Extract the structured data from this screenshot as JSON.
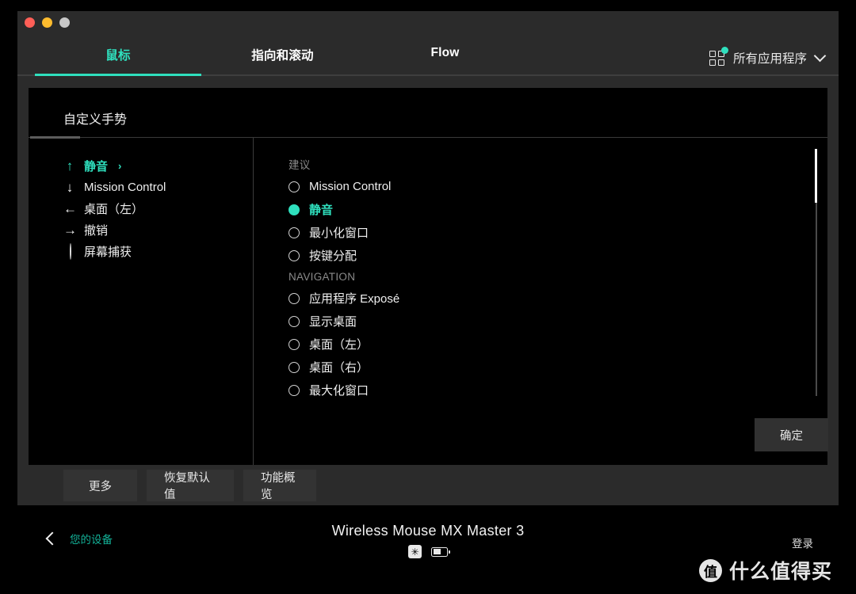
{
  "window": {
    "traffic_lights": [
      "close",
      "minimize",
      "zoom"
    ],
    "accent_color": "#2fe0be",
    "chrome_color": "#2b2b2b"
  },
  "tabs": [
    {
      "label": "鼠标",
      "active": true
    },
    {
      "label": "指向和滚动",
      "active": false
    },
    {
      "label": "Flow",
      "active": false
    }
  ],
  "all_apps": {
    "label": "所有应用程序",
    "icon": "grid-icon",
    "chevron": "chevron-down-icon"
  },
  "dialog": {
    "title": "自定义手势",
    "gestures": [
      {
        "icon": "arrow-up",
        "glyph": "↑",
        "label": "静音",
        "active": true,
        "chevron": "›"
      },
      {
        "icon": "arrow-down",
        "glyph": "↓",
        "label": "Mission Control",
        "active": false
      },
      {
        "icon": "arrow-left",
        "glyph": "←",
        "label": "桌面（左）",
        "active": false
      },
      {
        "icon": "arrow-right",
        "glyph": "→",
        "label": "撤销",
        "active": false
      },
      {
        "icon": "circle",
        "glyph": "",
        "label": "屏幕捕获",
        "active": false
      }
    ],
    "actions": {
      "groups": [
        {
          "label": "建议",
          "options": [
            {
              "label": "Mission Control",
              "selected": false
            },
            {
              "label": "静音",
              "selected": true
            },
            {
              "label": "最小化窗口",
              "selected": false
            },
            {
              "label": "按键分配",
              "selected": false
            }
          ]
        },
        {
          "label": "NAVIGATION",
          "options": [
            {
              "label": "应用程序 Exposé",
              "selected": false
            },
            {
              "label": "显示桌面",
              "selected": false
            },
            {
              "label": "桌面（左）",
              "selected": false
            },
            {
              "label": "桌面（右）",
              "selected": false
            },
            {
              "label": "最大化窗口",
              "selected": false
            }
          ]
        }
      ]
    },
    "confirm_label": "确定"
  },
  "bottom_buttons": [
    {
      "label": "更多"
    },
    {
      "label": "恢复默认值"
    },
    {
      "label": "功能概览"
    }
  ],
  "footer": {
    "back_label": "您的设备",
    "back_icon": "chevron-left-icon",
    "device_name": "Wireless Mouse MX Master 3",
    "device_icons": [
      "unifying-receiver-icon",
      "battery-icon"
    ],
    "unifying_glyph": "✳",
    "login_label": "登录"
  },
  "watermark": {
    "badge": "值",
    "text": "什么值得买"
  }
}
